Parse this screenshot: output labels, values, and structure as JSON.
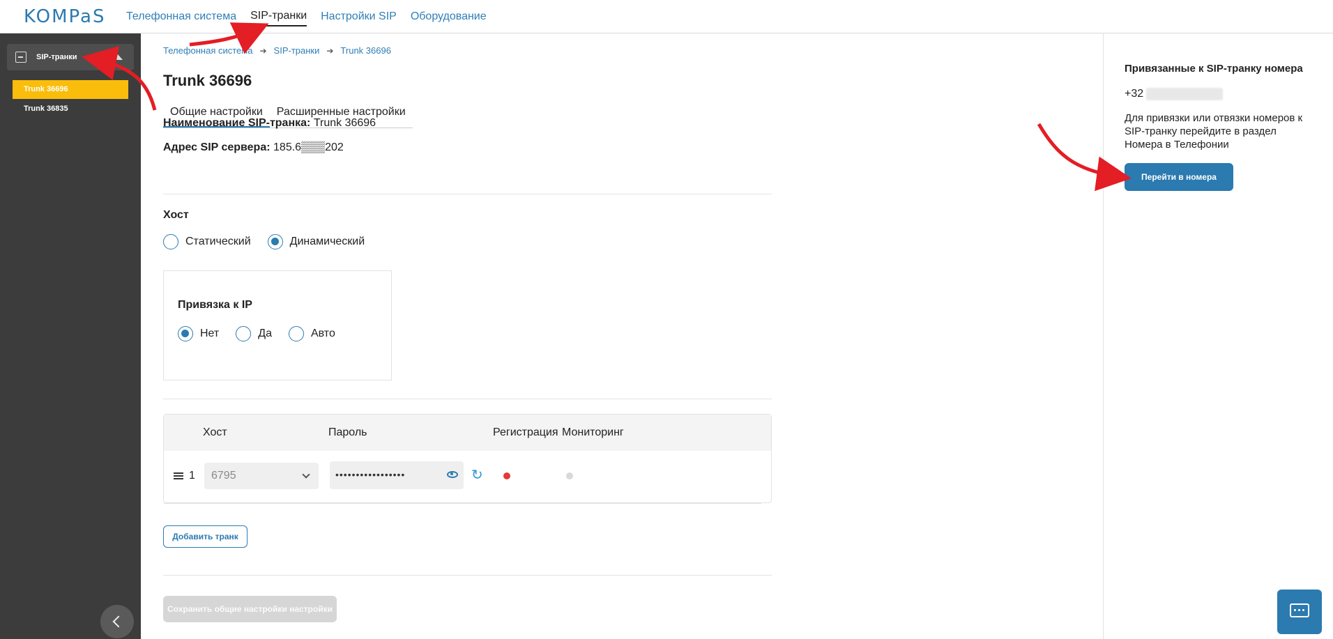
{
  "brand": {
    "logo_text": "KOMPaS"
  },
  "topnav": {
    "items": [
      "Телефонная система",
      "SIP-транки",
      "Настройки SIP",
      "Оборудование"
    ],
    "active_index": 1
  },
  "sidebar": {
    "group_label": "SIP-транки",
    "items": [
      {
        "label": "Trunk 36696",
        "active": true
      },
      {
        "label": "Trunk 36835",
        "active": false
      }
    ]
  },
  "breadcrumb": [
    "Телефонная система",
    "SIP-транки",
    "Trunk 36696"
  ],
  "page": {
    "title": "Trunk 36696",
    "tabs": [
      "Общие настройки",
      "Расширенные настройки"
    ],
    "name_label": "Наименование SIP-транка:",
    "name_value": "Trunk 36696",
    "address_label": "Адрес SIP сервера:",
    "address_value": "185.6▒▒▒202",
    "host_title": "Хост",
    "host_options": [
      {
        "label": "Статический",
        "checked": false
      },
      {
        "label": "Динамический",
        "checked": true
      }
    ],
    "ip_title": "Привязка к IP",
    "ip_options": [
      {
        "label": "Нет",
        "checked": true
      },
      {
        "label": "Да",
        "checked": false
      },
      {
        "label": "Авто",
        "checked": false
      }
    ]
  },
  "table": {
    "headers": [
      "Хост",
      "Пароль",
      "Регистрация",
      "Мониторинг"
    ],
    "rows": [
      {
        "num": "1",
        "host": "6795",
        "password": "•••••••••••••••••",
        "registration_color": "#e53935",
        "monitoring_color": "#d9d9d9"
      }
    ]
  },
  "buttons": {
    "add_trunk": "Добавить транк",
    "save": "Сохранить общие настройки настройки"
  },
  "right_panel": {
    "title": "Привязанные к SIP-транку номера",
    "phone_prefix": "+32",
    "info": "Для привязки или отвязки номеров к SIP-транку перейдите в раздел Номера в Телефонии",
    "go_button": "Перейти в номера"
  },
  "colors": {
    "accent": "#2b7ab0",
    "highlight": "#fbbd0b",
    "sidebar_bg": "#3c3c3c",
    "annotation_arrow": "#e31e24"
  }
}
